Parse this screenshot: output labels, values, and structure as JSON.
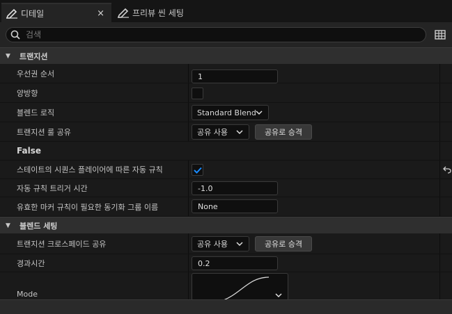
{
  "tabs": [
    {
      "label": "디테일",
      "icon": "pencil-icon",
      "active": true
    },
    {
      "label": "프리뷰 씬 세팅",
      "icon": "pencil-icon",
      "active": false
    }
  ],
  "close_glyph": "×",
  "search": {
    "placeholder": "검색"
  },
  "sections": {
    "transition": {
      "title": "트랜지션",
      "priority": {
        "label": "우선권 순서",
        "value": "1"
      },
      "bidirectional": {
        "label": "양방향",
        "checked": false
      },
      "blend_logic": {
        "label": "블렌드 로직",
        "value": "Standard Blend"
      },
      "transition_rule_share": {
        "label": "트랜지션 룰 공유",
        "combo": "공유 사용",
        "button": "공유로 승격"
      },
      "false_label": "False",
      "auto_rule": {
        "label": "스테이트의 시퀀스 플레이어에 따른 자동 규칙",
        "checked": true
      },
      "auto_rule_time": {
        "label": "자동 규칙 트리거 시간",
        "value": "-1.0"
      },
      "sync_group": {
        "label": "유효한 마커 규칙이 필요한 동기화 그룹 이름",
        "value": "None"
      }
    },
    "blend": {
      "title": "블렌드 세팅",
      "crossfade_share": {
        "label": "트랜지션 크로스페이드 공유",
        "combo": "공유 사용",
        "button": "공유로 승격"
      },
      "duration": {
        "label": "경과시간",
        "value": "0.2"
      },
      "mode": {
        "label": "Mode"
      }
    }
  },
  "colors": {
    "accent": "#1a8cff",
    "bg": "#1a1a1a",
    "header": "#2f2f2f"
  }
}
